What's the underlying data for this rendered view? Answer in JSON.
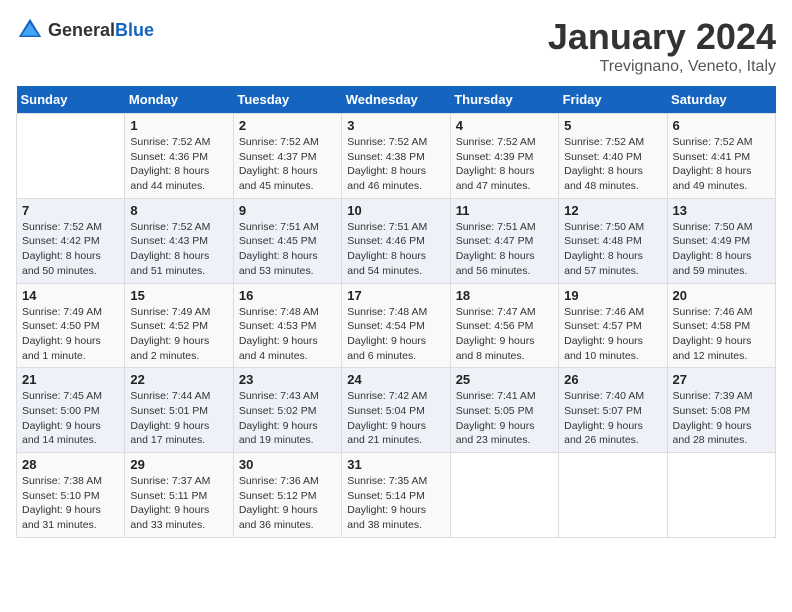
{
  "header": {
    "logo_general": "General",
    "logo_blue": "Blue",
    "month": "January 2024",
    "location": "Trevignano, Veneto, Italy"
  },
  "columns": [
    "Sunday",
    "Monday",
    "Tuesday",
    "Wednesday",
    "Thursday",
    "Friday",
    "Saturday"
  ],
  "weeks": [
    [
      {
        "day": "",
        "text": ""
      },
      {
        "day": "1",
        "text": "Sunrise: 7:52 AM\nSunset: 4:36 PM\nDaylight: 8 hours and 44 minutes."
      },
      {
        "day": "2",
        "text": "Sunrise: 7:52 AM\nSunset: 4:37 PM\nDaylight: 8 hours and 45 minutes."
      },
      {
        "day": "3",
        "text": "Sunrise: 7:52 AM\nSunset: 4:38 PM\nDaylight: 8 hours and 46 minutes."
      },
      {
        "day": "4",
        "text": "Sunrise: 7:52 AM\nSunset: 4:39 PM\nDaylight: 8 hours and 47 minutes."
      },
      {
        "day": "5",
        "text": "Sunrise: 7:52 AM\nSunset: 4:40 PM\nDaylight: 8 hours and 48 minutes."
      },
      {
        "day": "6",
        "text": "Sunrise: 7:52 AM\nSunset: 4:41 PM\nDaylight: 8 hours and 49 minutes."
      }
    ],
    [
      {
        "day": "7",
        "text": "Sunrise: 7:52 AM\nSunset: 4:42 PM\nDaylight: 8 hours and 50 minutes."
      },
      {
        "day": "8",
        "text": "Sunrise: 7:52 AM\nSunset: 4:43 PM\nDaylight: 8 hours and 51 minutes."
      },
      {
        "day": "9",
        "text": "Sunrise: 7:51 AM\nSunset: 4:45 PM\nDaylight: 8 hours and 53 minutes."
      },
      {
        "day": "10",
        "text": "Sunrise: 7:51 AM\nSunset: 4:46 PM\nDaylight: 8 hours and 54 minutes."
      },
      {
        "day": "11",
        "text": "Sunrise: 7:51 AM\nSunset: 4:47 PM\nDaylight: 8 hours and 56 minutes."
      },
      {
        "day": "12",
        "text": "Sunrise: 7:50 AM\nSunset: 4:48 PM\nDaylight: 8 hours and 57 minutes."
      },
      {
        "day": "13",
        "text": "Sunrise: 7:50 AM\nSunset: 4:49 PM\nDaylight: 8 hours and 59 minutes."
      }
    ],
    [
      {
        "day": "14",
        "text": "Sunrise: 7:49 AM\nSunset: 4:50 PM\nDaylight: 9 hours and 1 minute."
      },
      {
        "day": "15",
        "text": "Sunrise: 7:49 AM\nSunset: 4:52 PM\nDaylight: 9 hours and 2 minutes."
      },
      {
        "day": "16",
        "text": "Sunrise: 7:48 AM\nSunset: 4:53 PM\nDaylight: 9 hours and 4 minutes."
      },
      {
        "day": "17",
        "text": "Sunrise: 7:48 AM\nSunset: 4:54 PM\nDaylight: 9 hours and 6 minutes."
      },
      {
        "day": "18",
        "text": "Sunrise: 7:47 AM\nSunset: 4:56 PM\nDaylight: 9 hours and 8 minutes."
      },
      {
        "day": "19",
        "text": "Sunrise: 7:46 AM\nSunset: 4:57 PM\nDaylight: 9 hours and 10 minutes."
      },
      {
        "day": "20",
        "text": "Sunrise: 7:46 AM\nSunset: 4:58 PM\nDaylight: 9 hours and 12 minutes."
      }
    ],
    [
      {
        "day": "21",
        "text": "Sunrise: 7:45 AM\nSunset: 5:00 PM\nDaylight: 9 hours and 14 minutes."
      },
      {
        "day": "22",
        "text": "Sunrise: 7:44 AM\nSunset: 5:01 PM\nDaylight: 9 hours and 17 minutes."
      },
      {
        "day": "23",
        "text": "Sunrise: 7:43 AM\nSunset: 5:02 PM\nDaylight: 9 hours and 19 minutes."
      },
      {
        "day": "24",
        "text": "Sunrise: 7:42 AM\nSunset: 5:04 PM\nDaylight: 9 hours and 21 minutes."
      },
      {
        "day": "25",
        "text": "Sunrise: 7:41 AM\nSunset: 5:05 PM\nDaylight: 9 hours and 23 minutes."
      },
      {
        "day": "26",
        "text": "Sunrise: 7:40 AM\nSunset: 5:07 PM\nDaylight: 9 hours and 26 minutes."
      },
      {
        "day": "27",
        "text": "Sunrise: 7:39 AM\nSunset: 5:08 PM\nDaylight: 9 hours and 28 minutes."
      }
    ],
    [
      {
        "day": "28",
        "text": "Sunrise: 7:38 AM\nSunset: 5:10 PM\nDaylight: 9 hours and 31 minutes."
      },
      {
        "day": "29",
        "text": "Sunrise: 7:37 AM\nSunset: 5:11 PM\nDaylight: 9 hours and 33 minutes."
      },
      {
        "day": "30",
        "text": "Sunrise: 7:36 AM\nSunset: 5:12 PM\nDaylight: 9 hours and 36 minutes."
      },
      {
        "day": "31",
        "text": "Sunrise: 7:35 AM\nSunset: 5:14 PM\nDaylight: 9 hours and 38 minutes."
      },
      {
        "day": "",
        "text": ""
      },
      {
        "day": "",
        "text": ""
      },
      {
        "day": "",
        "text": ""
      }
    ]
  ]
}
